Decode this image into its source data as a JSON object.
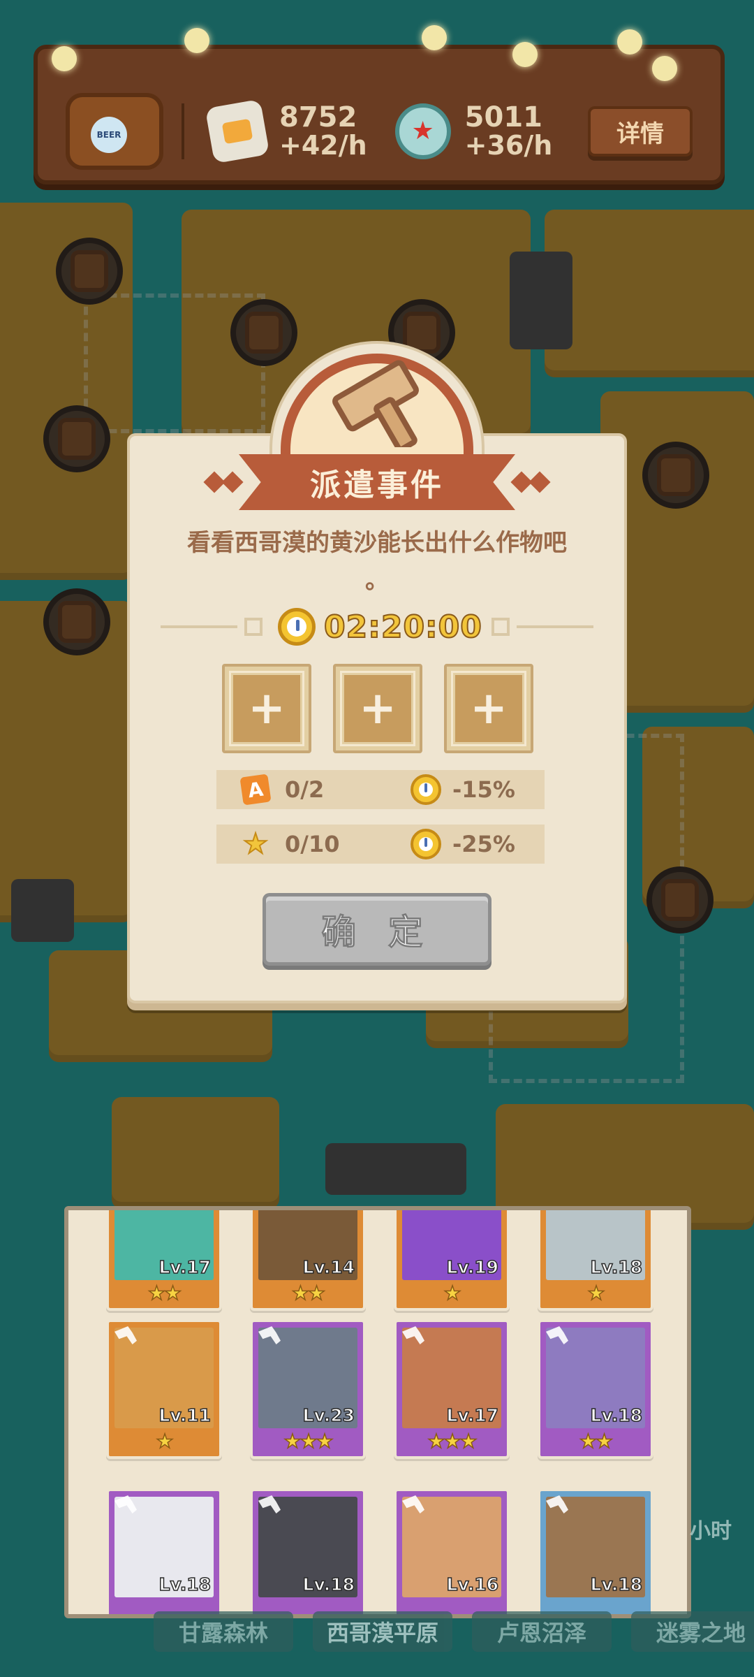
{
  "resources": {
    "food": {
      "icon": "snack-bag-icon",
      "amount": "8752",
      "rate": "+42/h"
    },
    "caps": {
      "icon": "bottle-cap-icon",
      "amount": "5011",
      "rate": "+36/h"
    },
    "detail_label": "详情",
    "barrel_icon": "beer-barrel-icon",
    "barrel_text": "BEER"
  },
  "dialog": {
    "title": "派遣事件",
    "description": "看看西哥漠的黄沙能长出什么作物吧",
    "description_tail": "。",
    "timer": "02:20:00",
    "slots": [
      "+",
      "+",
      "+"
    ],
    "requirements": [
      {
        "icon": "a-badge-icon",
        "icon_text": "A",
        "count": "0/2",
        "bonus": "-15%"
      },
      {
        "icon": "star-icon",
        "icon_text": "★",
        "count": "0/10",
        "bonus": "-25%"
      }
    ],
    "confirm_label": "确 定"
  },
  "characters": [
    {
      "level": "Lv.17",
      "stars": "★★",
      "rarity": "orange"
    },
    {
      "level": "Lv.14",
      "stars": "★★",
      "rarity": "orange"
    },
    {
      "level": "Lv.19",
      "stars": "★",
      "rarity": "orange"
    },
    {
      "level": "Lv.18",
      "stars": "★",
      "rarity": "orange"
    },
    {
      "level": "Lv.11",
      "stars": "★",
      "rarity": "orange"
    },
    {
      "level": "Lv.23",
      "stars": "★★★",
      "rarity": "purple"
    },
    {
      "level": "Lv.17",
      "stars": "★★★",
      "rarity": "purple"
    },
    {
      "level": "Lv.18",
      "stars": "★★",
      "rarity": "purple"
    },
    {
      "level": "Lv.18",
      "stars": "",
      "rarity": "purple"
    },
    {
      "level": "Lv.18",
      "stars": "",
      "rarity": "purple"
    },
    {
      "level": "Lv.16",
      "stars": "",
      "rarity": "purple"
    },
    {
      "level": "Lv.18",
      "stars": "",
      "rarity": "blue"
    }
  ],
  "tabs": [
    "甘露森林",
    "西哥漠平原",
    "卢恩沼泽",
    "迷雾之地"
  ],
  "hour_label": "小时",
  "colors": {
    "dialog_bg": "#efe5d1",
    "ribbon": "#b85c3a",
    "timer": "#f2c53b",
    "confirm_disabled": "#b9b9b9",
    "orange_card": "#de8b35",
    "purple_card": "#a15bc2",
    "blue_card": "#6aa4cd"
  }
}
